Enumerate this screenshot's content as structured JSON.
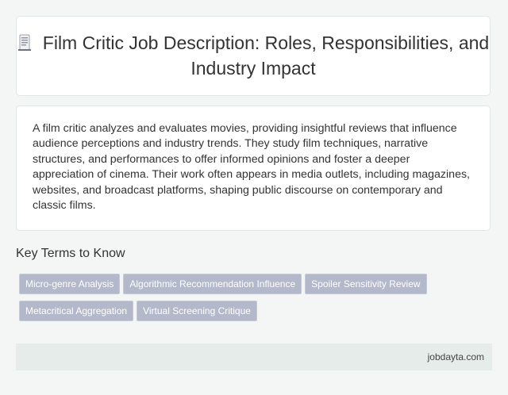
{
  "header": {
    "icon": "document-icon",
    "title": "Film Critic Job Description: Roles, Responsibilities, and Industry Impact"
  },
  "description": "A film critic analyzes and evaluates movies, providing insightful reviews that influence audience perceptions and industry trends. They study film techniques, narrative structures, and performances to offer informed opinions and foster a deeper appreciation of cinema. Their work often appears in media outlets, including magazines, websites, and broadcast platforms, shaping public discourse on contemporary and classic films.",
  "key_terms": {
    "heading": "Key Terms to Know",
    "tags": [
      "Micro-genre Analysis",
      "Algorithmic Recommendation Influence",
      "Spoiler Sensitivity Review",
      "Metacritical Aggregation",
      "Virtual Screening Critique"
    ]
  },
  "footer": {
    "site": "jobdayta.com"
  },
  "colors": {
    "background": "#f4f6f6",
    "tag": "#b3b9cb",
    "footer": "#e6ecea"
  }
}
